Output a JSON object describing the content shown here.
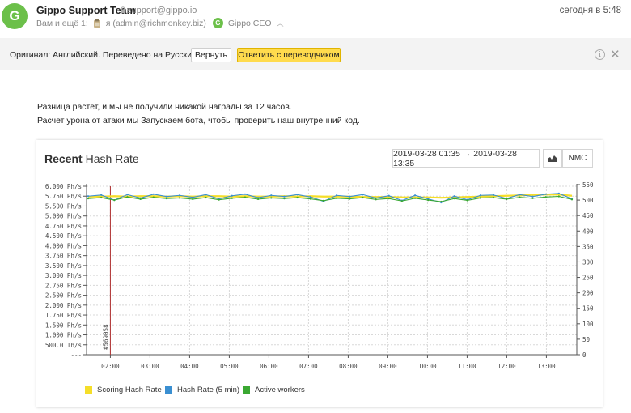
{
  "header": {
    "avatar_letter": "G",
    "sender_name": "Gippo Support Team",
    "sender_email": "support@gippo.io",
    "time": "сегодня в 5:48",
    "recipients_prefix": "Вам и ещё 1:",
    "recipient_me": "я (admin@richmonkey.biz)",
    "recipient_badge": "G",
    "recipient_other": "Gippo CEO"
  },
  "translation": {
    "message": "Оригинал: Английский. Переведено на Русский.",
    "return_label": "Вернуть",
    "reply_label": "Ответить с переводчиком",
    "info_icon": "i",
    "close_icon": "✕"
  },
  "body": {
    "line1": "Разница растет, и мы не получили никакой награды за 12 часов.",
    "line2": "Расчет урона от атаки мы Запускаем бота, чтобы проверить наш внутренний код."
  },
  "card": {
    "title_bold": "Recent",
    "title_rest": " Hash Rate",
    "date_range": "2019-03-28 01:35 → 2019-03-28 13:35",
    "currency_button": "NMC",
    "chart_icon": "area-chart-icon"
  },
  "chart_data": {
    "type": "line",
    "title": "Recent Hash Rate",
    "x_ticks": [
      "02:00",
      "03:00",
      "04:00",
      "05:00",
      "06:00",
      "07:00",
      "08:00",
      "09:00",
      "10:00",
      "11:00",
      "12:00",
      "13:00"
    ],
    "x_start": "01:35",
    "x_end": "13:35",
    "y_left_ticks": [
      "6.000 Ph/s",
      "5.750 Ph/s",
      "5.500 Ph/s",
      "5.000 Ph/s",
      "4.750 Ph/s",
      "4.500 Ph/s",
      "4.000 Ph/s",
      "3.750 Ph/s",
      "3.500 Ph/s",
      "3.000 Ph/s",
      "2.750 Ph/s",
      "2.500 Ph/s",
      "2.000 Ph/s",
      "1.750 Ph/s",
      "1.500 Ph/s",
      "1.000 Ph/s",
      "500.0 Th/s",
      "---"
    ],
    "y_right_ticks": [
      550,
      500,
      450,
      400,
      350,
      300,
      250,
      200,
      150,
      100,
      50,
      0
    ],
    "y_right_range": [
      0,
      550
    ],
    "block_marker": {
      "label": "#569058",
      "time": "02:00"
    },
    "series": [
      {
        "name": "Scoring Hash Rate",
        "color": "#f5de29",
        "values": [
          5.74,
          5.74,
          5.75,
          5.74,
          5.75,
          5.75,
          5.74,
          5.75,
          5.74,
          5.75,
          5.75,
          5.74,
          5.75,
          5.74,
          5.74,
          5.75,
          5.74,
          5.75,
          5.74,
          5.74,
          5.74,
          5.73,
          5.73,
          5.73,
          5.72,
          5.72,
          5.72,
          5.71,
          5.72,
          5.73,
          5.74,
          5.75,
          5.76,
          5.77,
          5.78,
          5.79,
          5.79,
          5.76
        ]
      },
      {
        "name": "Hash Rate (5 min)",
        "color": "#3a8fd1",
        "values": [
          5.75,
          5.78,
          5.65,
          5.79,
          5.7,
          5.8,
          5.74,
          5.77,
          5.72,
          5.79,
          5.68,
          5.76,
          5.8,
          5.71,
          5.77,
          5.74,
          5.79,
          5.73,
          5.62,
          5.77,
          5.74,
          5.79,
          5.7,
          5.76,
          5.64,
          5.77,
          5.68,
          5.59,
          5.75,
          5.66,
          5.77,
          5.78,
          5.69,
          5.79,
          5.74,
          5.8,
          5.82,
          5.68
        ]
      },
      {
        "name": "Active workers",
        "color": "#3aa832",
        "values": [
          505,
          508,
          500,
          510,
          503,
          509,
          505,
          507,
          503,
          508,
          501,
          506,
          509,
          503,
          507,
          505,
          508,
          504,
          498,
          506,
          504,
          508,
          502,
          505,
          497,
          506,
          500,
          495,
          505,
          499,
          507,
          508,
          503,
          509,
          506,
          510,
          512,
          502
        ]
      }
    ],
    "xlabel": "",
    "ylabel": "",
    "grid": true,
    "legend": "bottom"
  }
}
